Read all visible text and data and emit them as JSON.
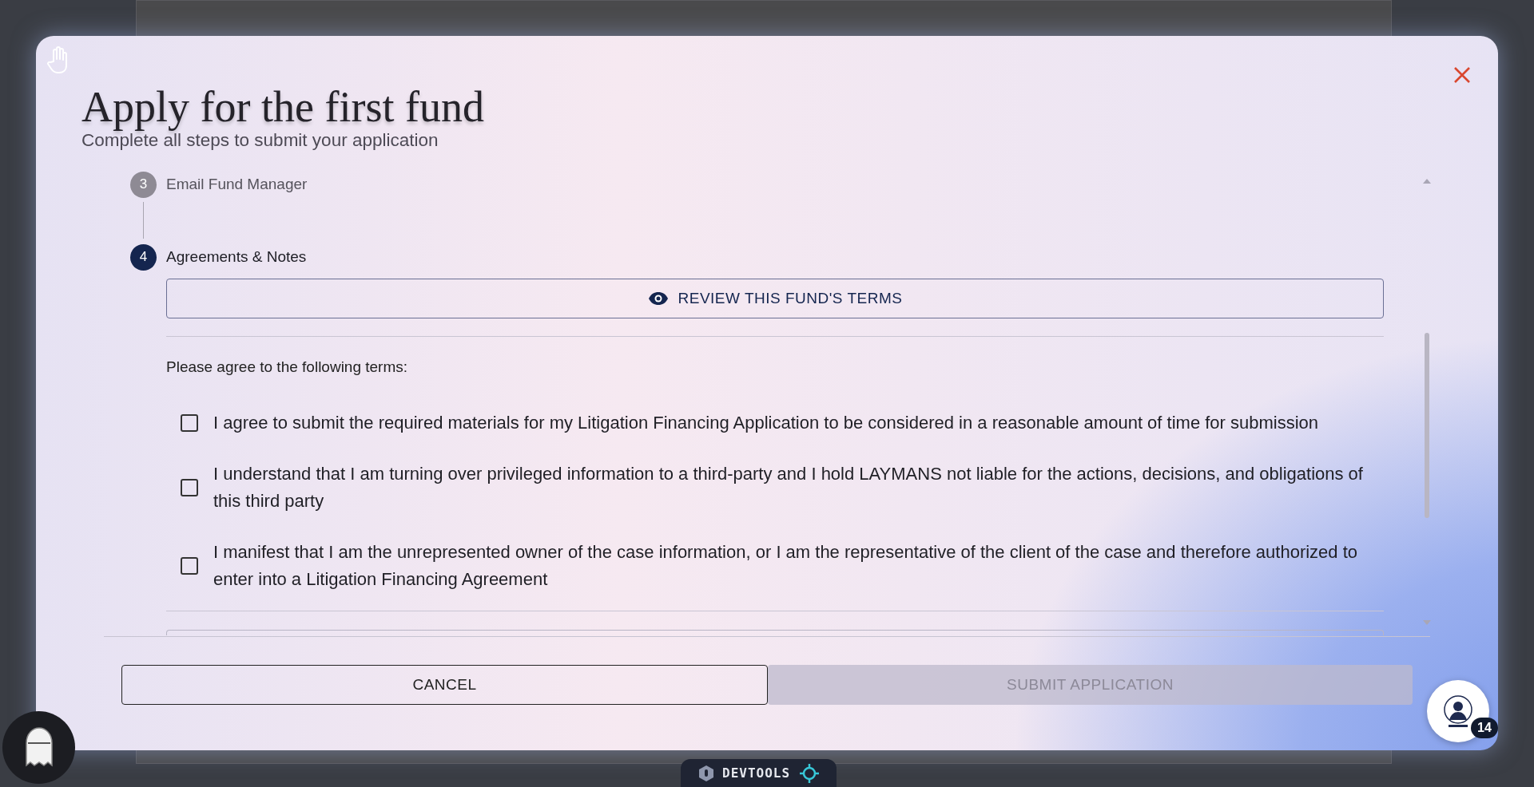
{
  "dialog": {
    "title": "Apply for the first fund",
    "subtitle": "Complete all steps to submit your application"
  },
  "steps": [
    {
      "number": "3",
      "label": "Email Fund Manager",
      "active": false
    },
    {
      "number": "4",
      "label": "Agreements & Notes",
      "active": true
    }
  ],
  "review_button": {
    "label": "REVIEW THIS FUND'S TERMS"
  },
  "terms": {
    "prompt": "Please agree to the following terms:",
    "items": [
      {
        "label": "I agree to submit the required materials for my Litigation Financing Application to be considered in a reasonable amount of time for submission",
        "checked": false
      },
      {
        "label": "I understand that I am turning over privileged information to a third-party and I hold LAYMANS not liable for the actions, decisions, and obligations of this third party",
        "checked": false
      },
      {
        "label": "I manifest that I am the unrepresented owner of the case information, or I am the representative of the client of the case and therefore authorized to enter into a Litigation Financing Agreement",
        "checked": false
      }
    ]
  },
  "footer": {
    "buttons": [
      {
        "label": "CANCEL",
        "disabled": false
      },
      {
        "label": "SUBMIT APPLICATION",
        "disabled": true
      }
    ]
  },
  "chat_badge": {
    "count": "14"
  },
  "devtools": {
    "label": "DEVTOOLS"
  }
}
